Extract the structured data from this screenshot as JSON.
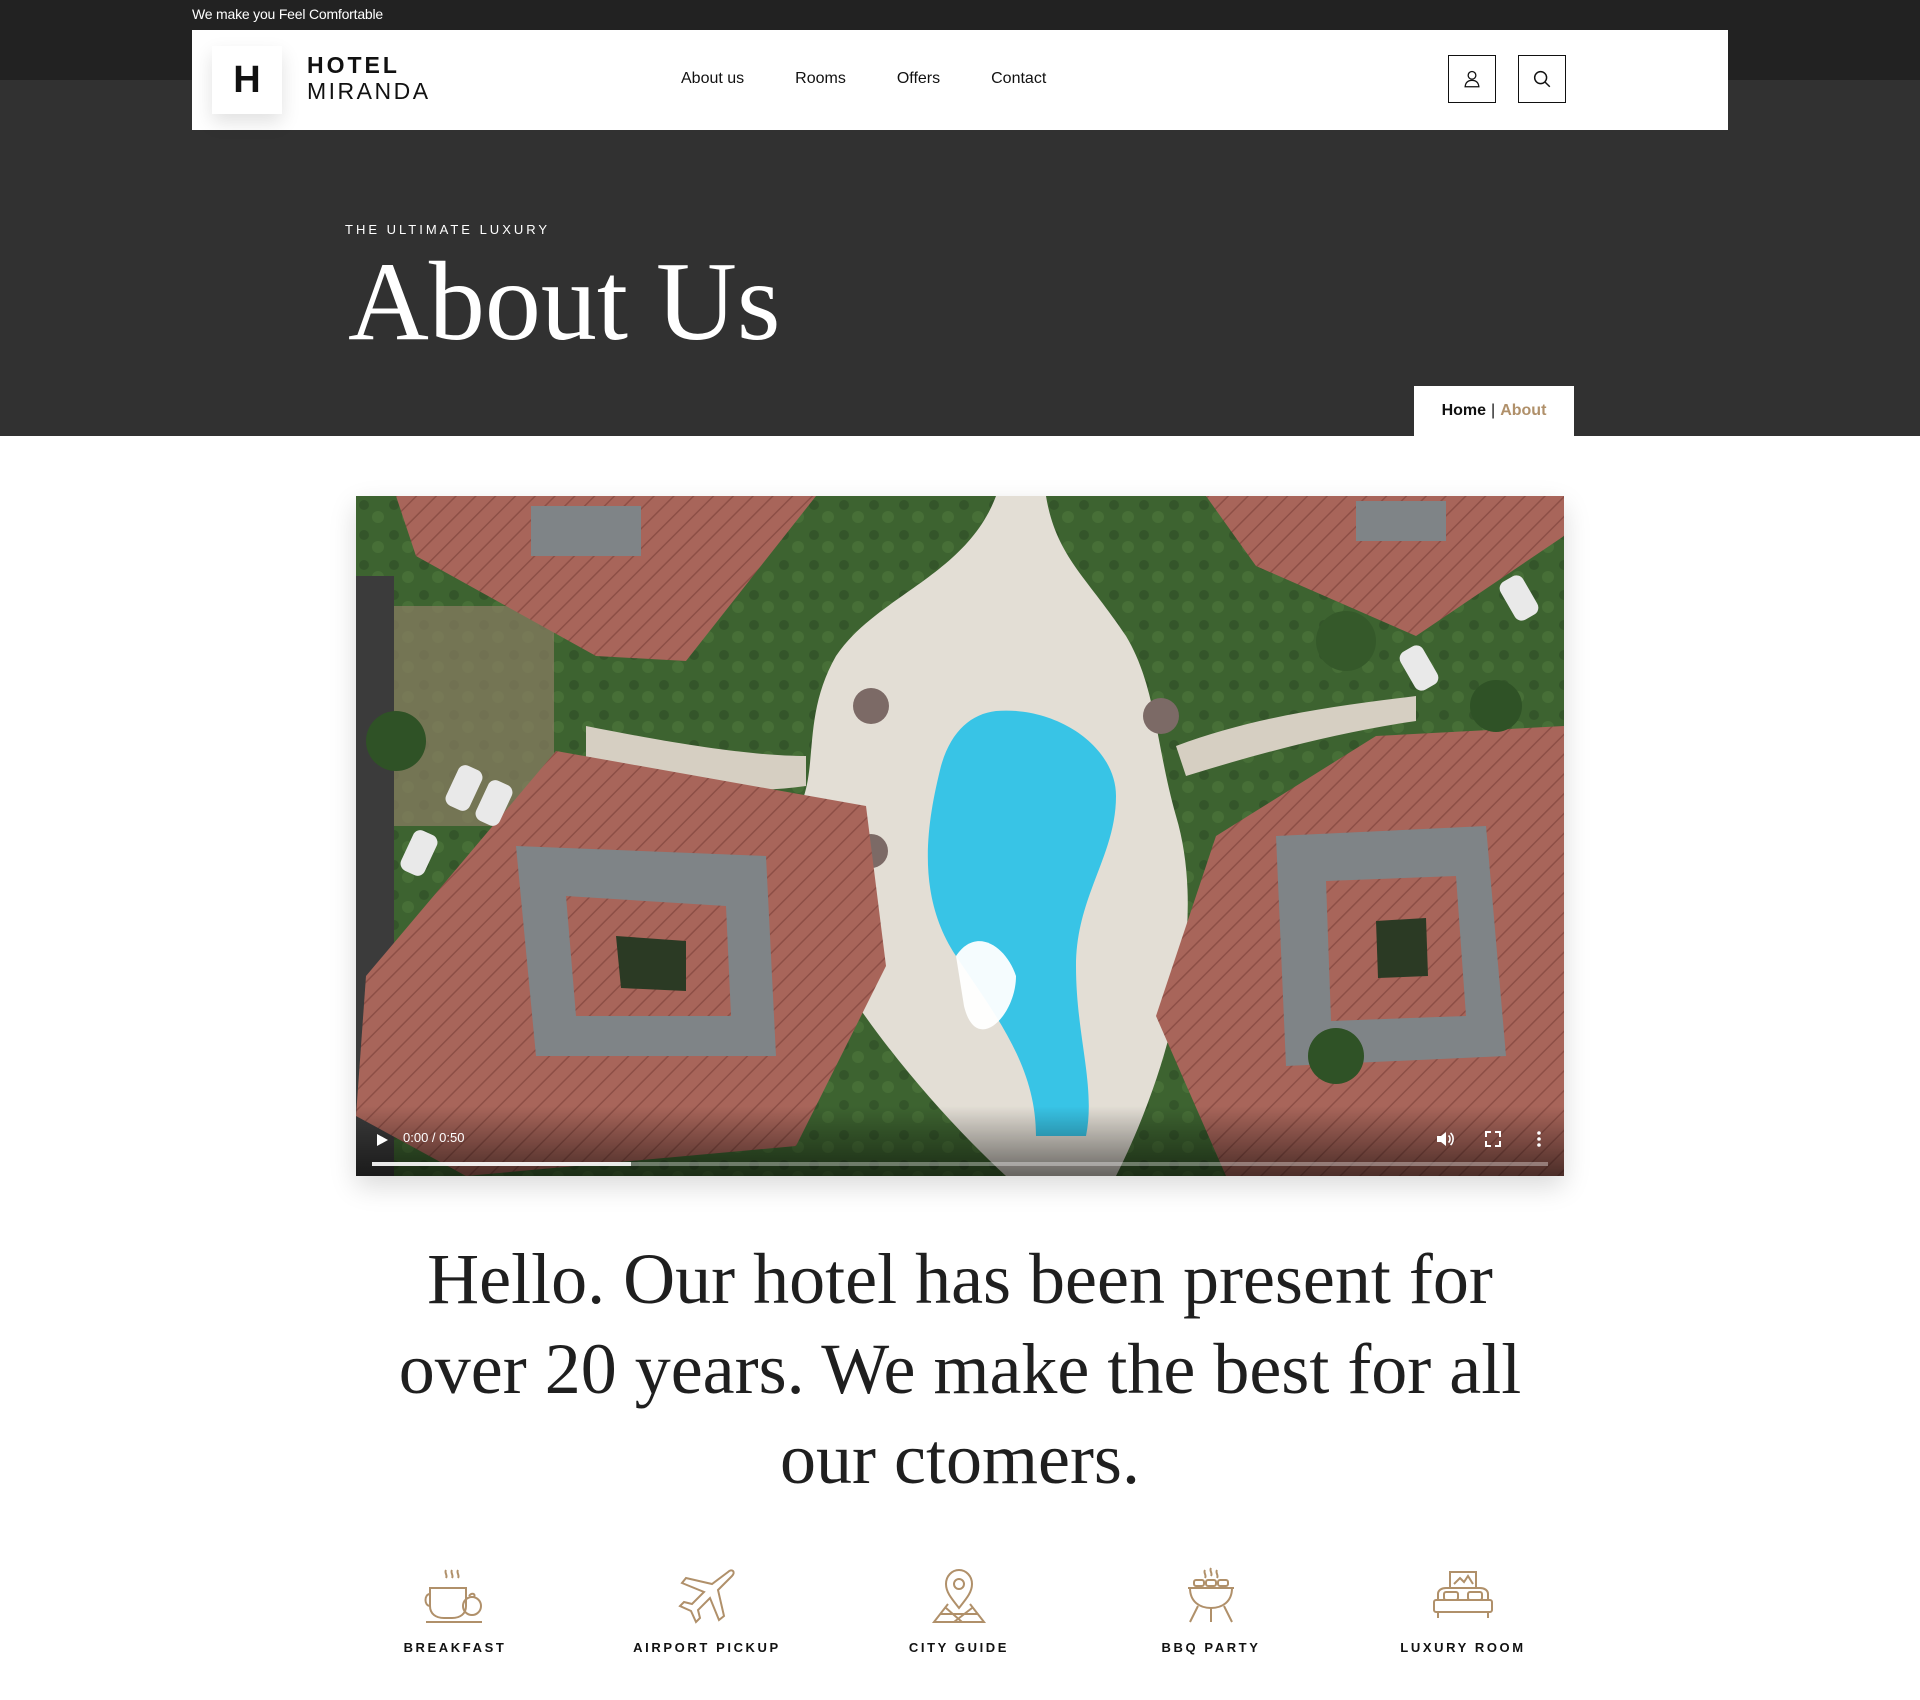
{
  "topbar": {
    "tagline": "We make you Feel Comfortable"
  },
  "header": {
    "logo_letter": "H",
    "brand_line1": "HOTEL",
    "brand_line2": "MIRANDA",
    "nav": [
      "About us",
      "Rooms",
      "Offers",
      "Contact"
    ],
    "user_icon": "user-icon",
    "search_icon": "search-icon"
  },
  "hero": {
    "kicker": "THE ULTIMATE LUXURY",
    "title": "About Us",
    "breadcrumb_home": "Home",
    "breadcrumb_separator": "|",
    "breadcrumb_current": "About"
  },
  "video": {
    "time": "0:00 / 0:50",
    "progress_buffered": 0.22,
    "play_icon": "play-icon",
    "volume_icon": "volume-icon",
    "fullscreen_icon": "fullscreen-icon",
    "more_icon": "more-vertical-icon"
  },
  "headline": "Hello. Our hotel has been present for over 20 years. We make the best for all our ctomers.",
  "features": [
    {
      "label": "BREAKFAST",
      "icon": "breakfast-icon"
    },
    {
      "label": "AIRPORT PICKUP",
      "icon": "airplane-icon"
    },
    {
      "label": "CITY GUIDE",
      "icon": "map-pin-icon"
    },
    {
      "label": "BBQ PARTY",
      "icon": "bbq-grill-icon"
    },
    {
      "label": "LUXURY ROOM",
      "icon": "bed-icon"
    }
  ],
  "colors": {
    "topbar_bg": "#222222",
    "hero_bg": "#313131",
    "accent_gold": "#b0906a",
    "text_dark": "#111111"
  }
}
